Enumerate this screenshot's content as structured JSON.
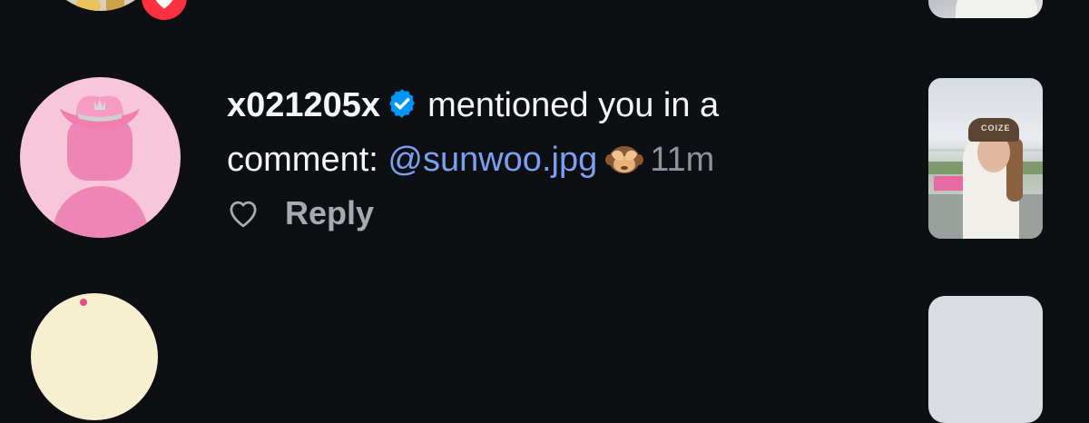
{
  "notification": {
    "username": "x021205x",
    "message": "mentioned you in a comment:",
    "mention": "@sunwoo.jpg",
    "time": "11m",
    "reply_label": "Reply",
    "cap_text": "COIZE"
  },
  "colors": {
    "background": "#0d0f13",
    "mention": "#7c9ff1",
    "verified": "#0095f6",
    "like_badge": "#ff3040",
    "muted": "#8e939b"
  },
  "icons": {
    "verified": "verified-badge-icon",
    "like": "heart-outline-icon",
    "like_badge": "heart-filled-icon",
    "emoji": "see-no-evil-monkey-emoji"
  }
}
